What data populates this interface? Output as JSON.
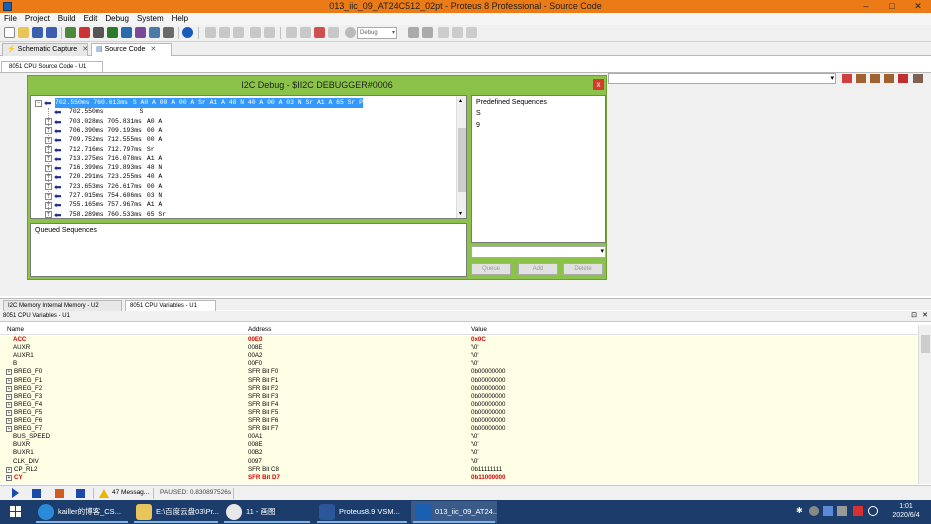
{
  "window": {
    "title": "013_iic_09_AT24C512_02pt - Proteus 8 Professional - Source Code",
    "minimize": "–",
    "maximize": "□",
    "close": "✕"
  },
  "menu": [
    "File",
    "Project",
    "Build",
    "Edit",
    "Debug",
    "System",
    "Help"
  ],
  "toolbar": {
    "debug_select": "Debug"
  },
  "tabs": [
    {
      "label": "Schematic Capture",
      "close": "✕"
    },
    {
      "label": "Source Code",
      "close": "✕"
    }
  ],
  "source_tab": "8051 CPU Source Code - U1",
  "dialog": {
    "title": "I2C Debug - $II2C DEBUGGER#0006",
    "close": "x",
    "tree_rows": [
      {
        "time": "702.550ms 760.613ms",
        "data": "S A0 A 00 A 00 A Sr A1 A 48 N 40 A 00 A 03 N Sr A1 A 65 Sr P",
        "expander": "−"
      },
      {
        "time": "702.550ms",
        "data": "S",
        "expander": ""
      },
      {
        "time": "703.028ms 705.831ms",
        "data": "A0 A",
        "expander": "+"
      },
      {
        "time": "706.390ms 709.193ms",
        "data": "00 A",
        "expander": "+"
      },
      {
        "time": "709.752ms 712.555ms",
        "data": "00 A",
        "expander": "+"
      },
      {
        "time": "712.716ms 712.797ms",
        "data": "Sr",
        "expander": "+"
      },
      {
        "time": "713.275ms 716.078ms",
        "data": "A1 A",
        "expander": "+"
      },
      {
        "time": "716.399ms 719.893ms",
        "data": "48 N",
        "expander": "+"
      },
      {
        "time": "720.291ms 723.255ms",
        "data": "40 A",
        "expander": "+"
      },
      {
        "time": "723.653ms 726.617ms",
        "data": "00 A",
        "expander": "+"
      },
      {
        "time": "727.015ms 754.606ms",
        "data": "03 N",
        "expander": "+"
      },
      {
        "time": "755.165ms 757.967ms",
        "data": "A1 A",
        "expander": "+"
      },
      {
        "time": "758.289ms 760.533ms",
        "data": "65 Sr",
        "expander": "+"
      }
    ],
    "predefined": {
      "header": "Predefined Sequences",
      "items": [
        "S",
        "9"
      ]
    },
    "queued": {
      "header": "Queued Sequences"
    },
    "buttons": {
      "queue": "Queue",
      "add": "Add",
      "delete": "Delete"
    }
  },
  "bottom_tabs": [
    "I2C Memory Internal Memory - U2",
    "8051 CPU Variables - U1"
  ],
  "variables": {
    "title": "8051 CPU Variables - U1",
    "pin": "⊡",
    "close": "✕",
    "columns": [
      "Name",
      "Address",
      "Value"
    ],
    "rows": [
      {
        "name": "ACC",
        "address": "00E0",
        "value": "0x0C",
        "red": true,
        "expand": false
      },
      {
        "name": "AUXR",
        "address": "008E",
        "value": "'\\0'",
        "red": false,
        "expand": false
      },
      {
        "name": "AUXR1",
        "address": "00A2",
        "value": "'\\0'",
        "red": false,
        "expand": false
      },
      {
        "name": "B",
        "address": "00F0",
        "value": "'\\0'",
        "red": false,
        "expand": false
      },
      {
        "name": "BREG_F0",
        "address": "SFR Bit F0",
        "value": "0b00000000",
        "red": false,
        "expand": true
      },
      {
        "name": "BREG_F1",
        "address": "SFR Bit F1",
        "value": "0b00000000",
        "red": false,
        "expand": true
      },
      {
        "name": "BREG_F2",
        "address": "SFR Bit F2",
        "value": "0b00000000",
        "red": false,
        "expand": true
      },
      {
        "name": "BREG_F3",
        "address": "SFR Bit F3",
        "value": "0b00000000",
        "red": false,
        "expand": true
      },
      {
        "name": "BREG_F4",
        "address": "SFR Bit F4",
        "value": "0b00000000",
        "red": false,
        "expand": true
      },
      {
        "name": "BREG_F5",
        "address": "SFR Bit F5",
        "value": "0b00000000",
        "red": false,
        "expand": true
      },
      {
        "name": "BREG_F6",
        "address": "SFR Bit F6",
        "value": "0b00000000",
        "red": false,
        "expand": true
      },
      {
        "name": "BREG_F7",
        "address": "SFR Bit F7",
        "value": "0b00000000",
        "red": false,
        "expand": true
      },
      {
        "name": "BUS_SPEED",
        "address": "00A1",
        "value": "'\\0'",
        "red": false,
        "expand": false
      },
      {
        "name": "BUXR",
        "address": "008E",
        "value": "'\\0'",
        "red": false,
        "expand": false
      },
      {
        "name": "BUXR1",
        "address": "00B2",
        "value": "'\\0'",
        "red": false,
        "expand": false
      },
      {
        "name": "CLK_DIV",
        "address": "0097",
        "value": "'\\0'",
        "red": false,
        "expand": false
      },
      {
        "name": "CP_RL2",
        "address": "SFR Bit C8",
        "value": "0b11111111",
        "red": false,
        "expand": true
      },
      {
        "name": "CY",
        "address": "SFR Bit D7",
        "value": "0b11000000",
        "red": true,
        "expand": true
      }
    ]
  },
  "status": {
    "messages": "47 Messag...",
    "paused": "PAUSED: 0.830897526s"
  },
  "taskbar": {
    "items": [
      {
        "label": "kailler的博客_CS..."
      },
      {
        "label": "E:\\百度云盘03\\Pr..."
      },
      {
        "label": "11 - 画图"
      },
      {
        "label": "Proteus8.9 VSM..."
      },
      {
        "label": "013_iic_09_AT24..."
      }
    ],
    "time": "1:01",
    "date": "2020/6/4"
  },
  "colors": {
    "titlebar": "#ea7b17",
    "dialog_frame": "#8bc34a",
    "taskbar": "#1c3d6b",
    "variables_bg": "#ffffe6",
    "highlight_red": "#d40000",
    "selection_blue": "#3399ff"
  }
}
